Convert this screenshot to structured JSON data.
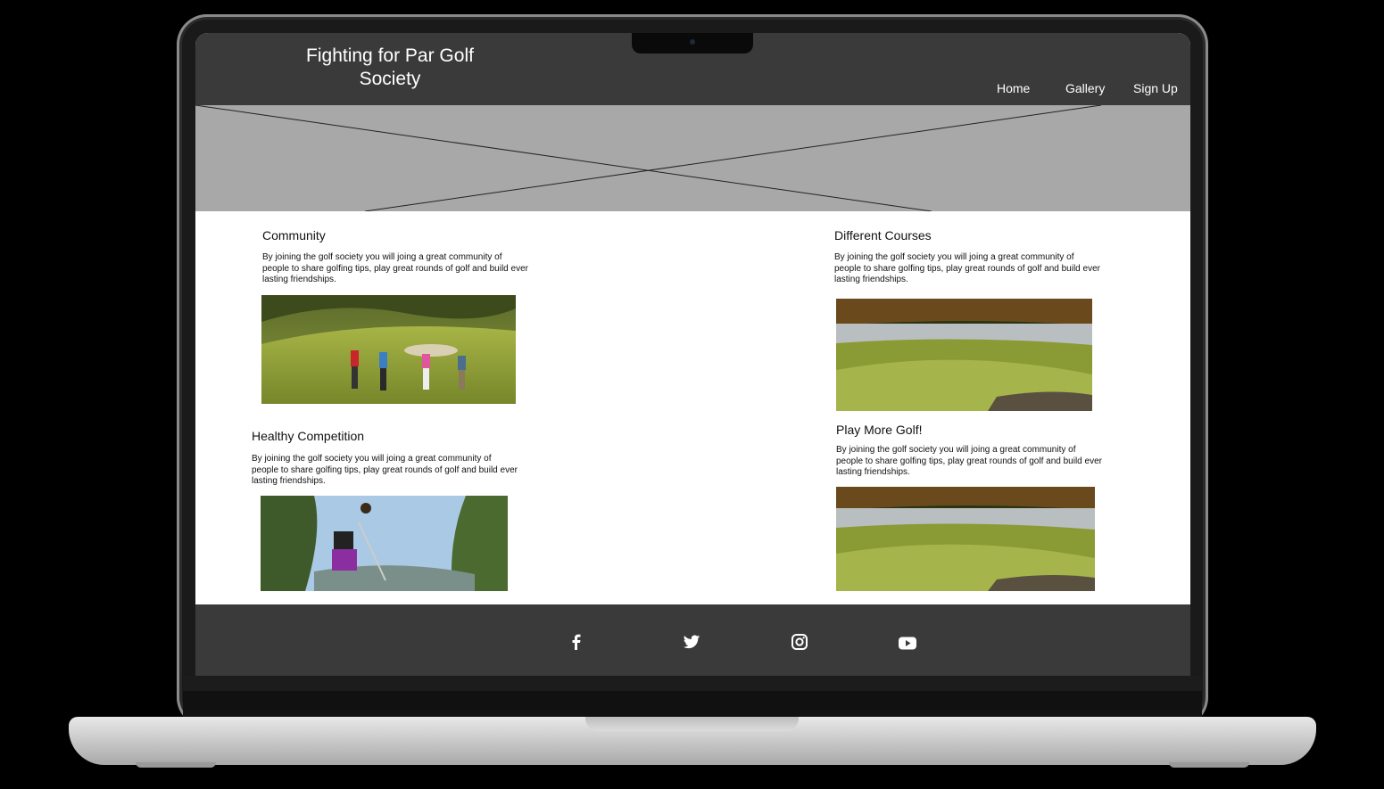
{
  "header": {
    "site_title": "Fighting for Par Golf Society",
    "nav": [
      "Home",
      "Gallery",
      "Sign Up"
    ]
  },
  "hero": {
    "placeholder_icon": "image-placeholder-cross"
  },
  "sections": [
    {
      "title": "Community",
      "text": "By joining the golf society you will joing a great community of people to share golfing tips, play great rounds of golf and build ever lasting friendships.",
      "image": "golfers-walking-photo"
    },
    {
      "title": "Healthy Competition",
      "text": "By joining the golf society you will joing a great community of people to share golfing tips, play great rounds of golf and build ever lasting friendships.",
      "image": "woman-golfer-swing-photo"
    },
    {
      "title": "Different Courses",
      "text": "By joining the golf society you will joing a great community of people to share golfing tips, play great rounds of golf and build ever lasting friendships.",
      "image": "golf-course-lake-photo"
    },
    {
      "title": "Play More Golf!",
      "text": "By joining the golf society you will joing a great community of people to share golfing tips, play great rounds of golf and build ever lasting friendships.",
      "image": "golf-green-lake-photo"
    }
  ],
  "footer": {
    "social_icons": [
      "facebook-icon",
      "twitter-icon",
      "instagram-icon",
      "youtube-icon"
    ]
  },
  "colors": {
    "header_bg": "#3a3a3a",
    "hero_placeholder": "#a8a8a8",
    "page_bg": "#ffffff",
    "text": "#111111"
  }
}
